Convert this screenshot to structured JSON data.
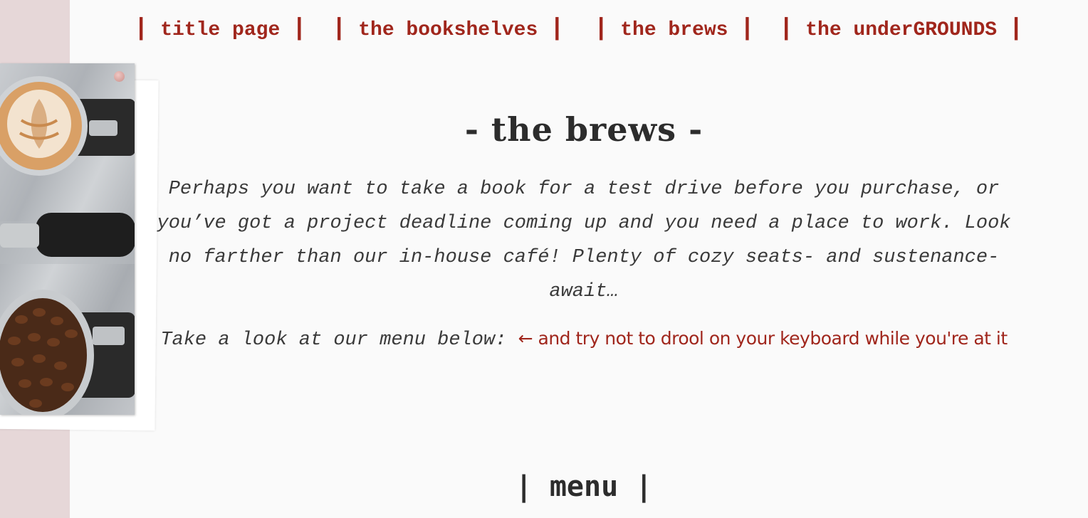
{
  "nav": {
    "items": [
      {
        "label": "title page"
      },
      {
        "label": "the bookshelves"
      },
      {
        "label": "the brews"
      },
      {
        "label": "the underGROUNDS"
      }
    ],
    "separator": "|"
  },
  "page": {
    "title": "- the brews -",
    "intro": "Perhaps you want to take a book for a test drive before you purchase, or you’ve got a project deadline coming up and you need a place to work. Look no farther than our in-house café! Plenty of cozy seats- and sustenance- await…",
    "menu_prompt": "Take a look at our menu below:",
    "menu_note": "← and try not to drool on your keyboard while you're at it",
    "menu_heading": "| menu |"
  },
  "colors": {
    "accent": "#a0261c",
    "text": "#3a3a3a",
    "background": "#fafafa",
    "side_strip": "#e6d7d8"
  },
  "images": {
    "collage": "coffee-photo (latte art, portafilters, coffee beans)"
  }
}
